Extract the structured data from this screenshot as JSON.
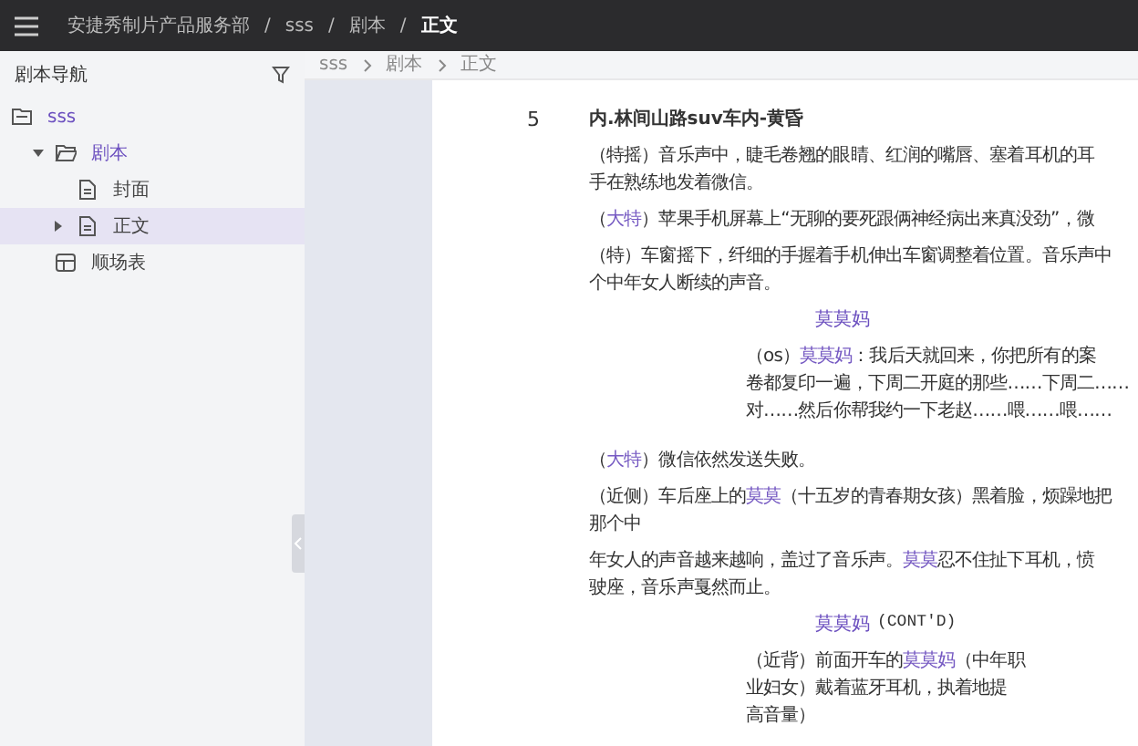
{
  "top_bar": {
    "breadcrumb": [
      {
        "label": "安捷秀制片产品服务部",
        "current": false
      },
      {
        "separator": "/",
        "label": "sss",
        "current": false
      },
      {
        "separator": "/",
        "label": "剧本",
        "current": false
      },
      {
        "separator": "/",
        "label": "正文",
        "current": true
      }
    ]
  },
  "sidebar": {
    "title": "剧本导航",
    "tree": [
      {
        "label": "sss",
        "kind": "project",
        "selected": false,
        "children": [
          {
            "label": "剧本",
            "kind": "folder",
            "expanded": true,
            "selected": false,
            "children": [
              {
                "label": "封面",
                "kind": "doc",
                "selected": false
              },
              {
                "label": "正文",
                "kind": "doc",
                "selected": true,
                "expanded": false,
                "has_children": true
              }
            ]
          },
          {
            "label": "顺场表",
            "kind": "table",
            "selected": false
          }
        ]
      }
    ]
  },
  "content_breadcrumb": [
    "sss",
    "剧本",
    "正文"
  ],
  "script": {
    "scene_number": "5",
    "heading": "内.林间山路suv车内-黄昏",
    "blocks": [
      {
        "kind": "action",
        "lines": [
          [
            {
              "text": "（特摇）音乐声中，睫毛卷翘的眼睛、红润的嘴唇、塞着耳机的耳",
              "highlight": false
            }
          ],
          [
            {
              "text": "手在熟练地发着微信。",
              "highlight": false
            }
          ]
        ]
      },
      {
        "kind": "action",
        "lines": [
          [
            {
              "text": "（",
              "highlight": false
            },
            {
              "text": "大特",
              "highlight": true
            },
            {
              "text": "）苹果手机屏幕上“无聊的要死跟俩神经病出来真没劲”，微",
              "highlight": false
            }
          ]
        ]
      },
      {
        "kind": "action",
        "lines": [
          [
            {
              "text": "（特）车窗摇下，纤细的手握着手机伸出车窗调整着位置。音乐声中",
              "highlight": false
            }
          ],
          [
            {
              "text": "个中年女人断续的声音。",
              "highlight": false
            }
          ]
        ]
      },
      {
        "kind": "character",
        "name": "莫莫妈"
      },
      {
        "kind": "dialogue",
        "lines": [
          [
            {
              "text": "（os）",
              "highlight": false
            },
            {
              "text": "莫莫妈",
              "highlight": true
            },
            {
              "text": "：我后天就回来，你把所有的案",
              "highlight": false
            }
          ],
          [
            {
              "text": "卷都复印一遍，下周二开庭的那些……下周二……",
              "highlight": false
            }
          ],
          [
            {
              "text": "对……然后你帮我约一下老赵……喂……喂……",
              "highlight": false
            }
          ]
        ]
      },
      {
        "kind": "action",
        "lines": [
          [
            {
              "text": "（",
              "highlight": false
            },
            {
              "text": "大特",
              "highlight": true
            },
            {
              "text": "）微信依然发送失败。",
              "highlight": false
            }
          ]
        ]
      },
      {
        "kind": "action",
        "lines": [
          [
            {
              "text": "（近侧）车后座上的",
              "highlight": false
            },
            {
              "text": "莫莫",
              "highlight": true
            },
            {
              "text": "（十五岁的青春期女孩）黑着脸，烦躁地把",
              "highlight": false
            }
          ],
          [
            {
              "text": "那个中",
              "highlight": false
            }
          ]
        ]
      },
      {
        "kind": "action",
        "lines": [
          [
            {
              "text": "年女人的声音越来越响，盖过了音乐声。",
              "highlight": false
            },
            {
              "text": "莫莫",
              "highlight": true
            },
            {
              "text": "忍不住扯下耳机，愤",
              "highlight": false
            }
          ],
          [
            {
              "text": "驶座，音乐声戛然而止。",
              "highlight": false
            }
          ]
        ]
      },
      {
        "kind": "character",
        "name": "莫莫妈",
        "extension": "(CONT'D)"
      },
      {
        "kind": "dialogue",
        "lines": [
          [
            {
              "text": "（近背）前面开车的",
              "highlight": false
            },
            {
              "text": "莫莫妈",
              "highlight": true
            },
            {
              "text": "（中年职",
              "highlight": false
            }
          ],
          [
            {
              "text": "业妇女）戴着蓝牙耳机，执着地提",
              "highlight": false
            }
          ],
          [
            {
              "text": "高音量）",
              "highlight": false
            }
          ]
        ]
      }
    ]
  }
}
